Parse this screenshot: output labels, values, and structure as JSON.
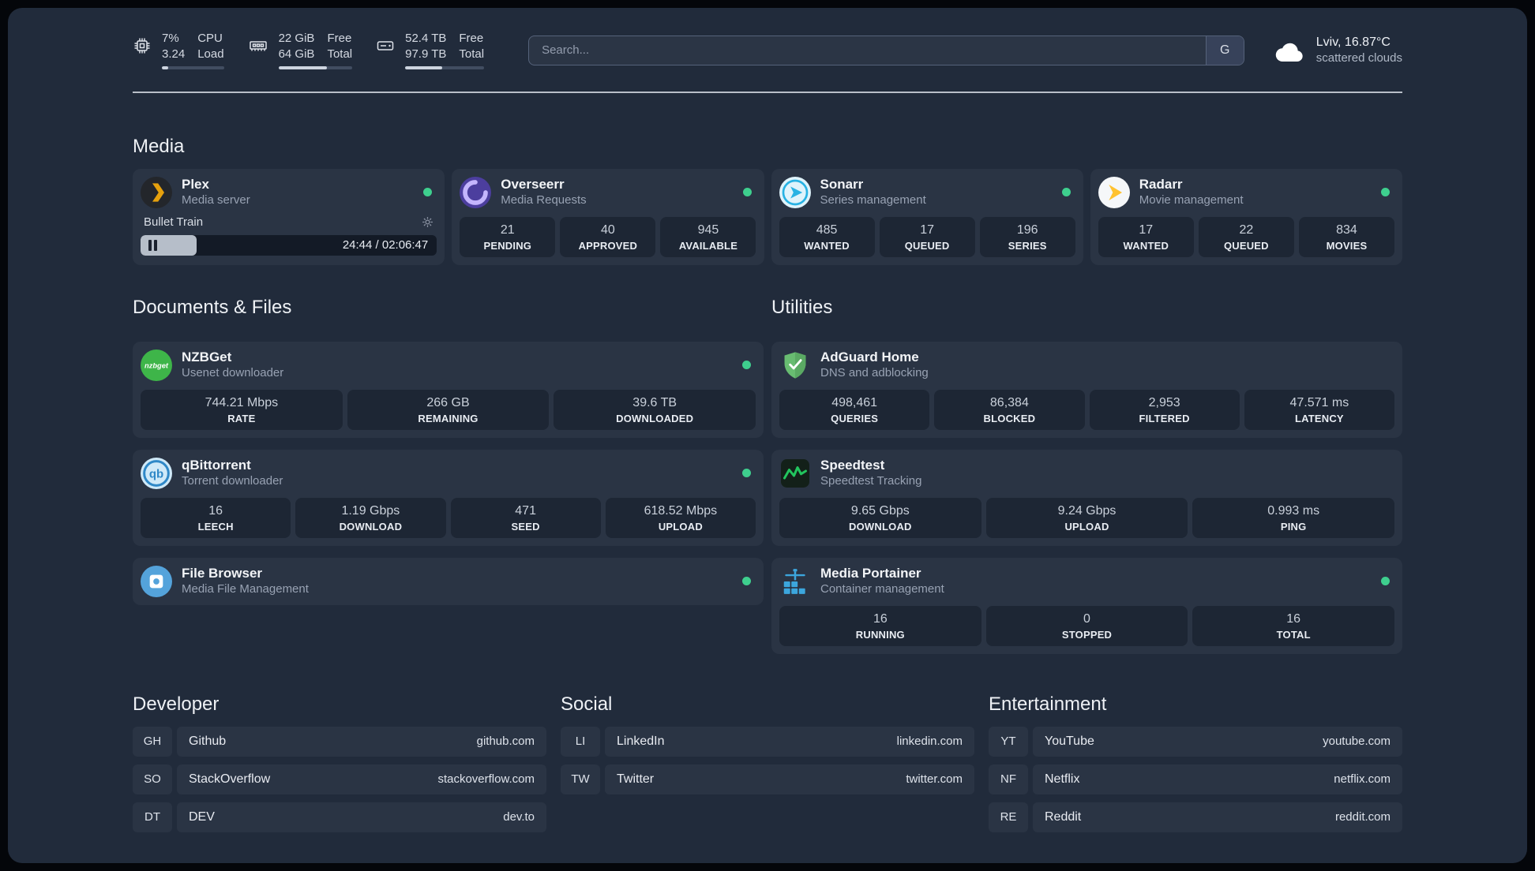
{
  "colors": {
    "status_online": "#3ecf8e",
    "panel_bg": "#212b3b",
    "card_bg": "#2a3444",
    "tile_bg": "#1d2634",
    "plex_accent": "#e5a00d",
    "adguard_green": "#68bc71",
    "speedtest_green": "#22c55e"
  },
  "topbar": {
    "cpu": {
      "icon": "cpu-chip-icon",
      "value_pct": "7%",
      "value_load": "3.24",
      "label_top": "CPU",
      "label_bottom": "Load",
      "progress": 10
    },
    "memory": {
      "icon": "memory-ram-icon",
      "value_free": "22 GiB",
      "value_total": "64 GiB",
      "label_top": "Free",
      "label_bottom": "Total",
      "progress": 66
    },
    "disk": {
      "icon": "hard-disk-icon",
      "value_free": "52.4 TB",
      "value_total": "97.9 TB",
      "label_top": "Free",
      "label_bottom": "Total",
      "progress": 47
    },
    "search": {
      "placeholder": "Search...",
      "button_label": "G"
    },
    "weather": {
      "icon": "cloud-icon",
      "location": "Lviv, 16.87°C",
      "condition": "scattered clouds"
    }
  },
  "sections": {
    "media": {
      "title": "Media",
      "cards": [
        {
          "icon": "plex-icon",
          "title": "Plex",
          "subtitle": "Media server",
          "online": true,
          "player": {
            "track": "Bullet Train",
            "time": "24:44 / 02:06:47",
            "progress": 19
          }
        },
        {
          "icon": "overseerr-icon",
          "title": "Overseerr",
          "subtitle": "Media Requests",
          "online": true,
          "stats": [
            {
              "value": "21",
              "label": "PENDING"
            },
            {
              "value": "40",
              "label": "APPROVED"
            },
            {
              "value": "945",
              "label": "AVAILABLE"
            }
          ]
        },
        {
          "icon": "sonarr-icon",
          "title": "Sonarr",
          "subtitle": "Series management",
          "online": true,
          "stats": [
            {
              "value": "485",
              "label": "WANTED"
            },
            {
              "value": "17",
              "label": "QUEUED"
            },
            {
              "value": "196",
              "label": "SERIES"
            }
          ]
        },
        {
          "icon": "radarr-icon",
          "title": "Radarr",
          "subtitle": "Movie management",
          "online": true,
          "stats": [
            {
              "value": "17",
              "label": "WANTED"
            },
            {
              "value": "22",
              "label": "QUEUED"
            },
            {
              "value": "834",
              "label": "MOVIES"
            }
          ]
        }
      ]
    },
    "documents": {
      "title": "Documents & Files",
      "cards": [
        {
          "icon": "nzbget-icon",
          "title": "NZBGet",
          "subtitle": "Usenet downloader",
          "online": true,
          "stats": [
            {
              "value": "744.21 Mbps",
              "label": "RATE"
            },
            {
              "value": "266 GB",
              "label": "REMAINING"
            },
            {
              "value": "39.6 TB",
              "label": "DOWNLOADED"
            }
          ]
        },
        {
          "icon": "qbittorrent-icon",
          "title": "qBittorrent",
          "subtitle": "Torrent downloader",
          "online": true,
          "stats": [
            {
              "value": "16",
              "label": "LEECH"
            },
            {
              "value": "1.19 Gbps",
              "label": "DOWNLOAD"
            },
            {
              "value": "471",
              "label": "SEED"
            },
            {
              "value": "618.52 Mbps",
              "label": "UPLOAD"
            }
          ]
        },
        {
          "icon": "filebrowser-icon",
          "title": "File Browser",
          "subtitle": "Media File Management",
          "online": true
        }
      ]
    },
    "utilities": {
      "title": "Utilities",
      "cards": [
        {
          "icon": "adguard-icon",
          "title": "AdGuard Home",
          "subtitle": "DNS and adblocking",
          "stats": [
            {
              "value": "498,461",
              "label": "QUERIES"
            },
            {
              "value": "86,384",
              "label": "BLOCKED"
            },
            {
              "value": "2,953",
              "label": "FILTERED"
            },
            {
              "value": "47.571 ms",
              "label": "LATENCY"
            }
          ]
        },
        {
          "icon": "speedtest-icon",
          "title": "Speedtest",
          "subtitle": "Speedtest Tracking",
          "stats": [
            {
              "value": "9.65 Gbps",
              "label": "DOWNLOAD"
            },
            {
              "value": "9.24 Gbps",
              "label": "UPLOAD"
            },
            {
              "value": "0.993 ms",
              "label": "PING"
            }
          ]
        },
        {
          "icon": "portainer-icon",
          "title": "Media Portainer",
          "subtitle": "Container management",
          "online": true,
          "stats": [
            {
              "value": "16",
              "label": "RUNNING"
            },
            {
              "value": "0",
              "label": "STOPPED"
            },
            {
              "value": "16",
              "label": "TOTAL"
            }
          ]
        }
      ]
    },
    "bookmarks": [
      {
        "title": "Developer",
        "items": [
          {
            "abbr": "GH",
            "name": "Github",
            "url": "github.com"
          },
          {
            "abbr": "SO",
            "name": "StackOverflow",
            "url": "stackoverflow.com"
          },
          {
            "abbr": "DT",
            "name": "DEV",
            "url": "dev.to"
          }
        ]
      },
      {
        "title": "Social",
        "items": [
          {
            "abbr": "LI",
            "name": "LinkedIn",
            "url": "linkedin.com"
          },
          {
            "abbr": "TW",
            "name": "Twitter",
            "url": "twitter.com"
          }
        ]
      },
      {
        "title": "Entertainment",
        "items": [
          {
            "abbr": "YT",
            "name": "YouTube",
            "url": "youtube.com"
          },
          {
            "abbr": "NF",
            "name": "Netflix",
            "url": "netflix.com"
          },
          {
            "abbr": "RE",
            "name": "Reddit",
            "url": "reddit.com"
          }
        ]
      }
    ]
  }
}
